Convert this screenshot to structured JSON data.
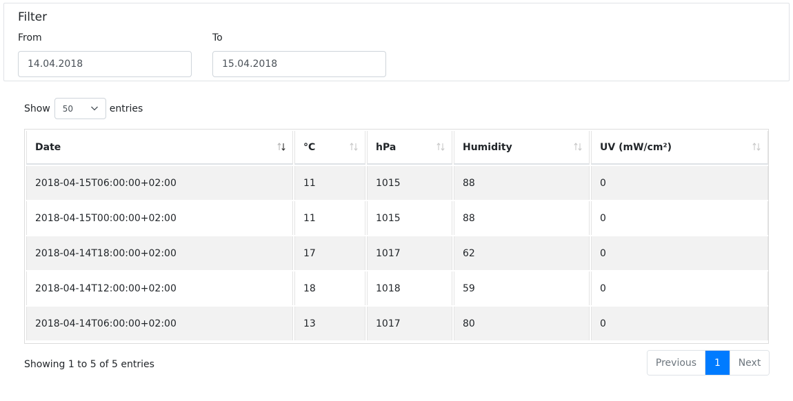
{
  "filter": {
    "title": "Filter",
    "from_label": "From",
    "from_value": "14.04.2018",
    "to_label": "To",
    "to_value": "15.04.2018"
  },
  "length": {
    "show_label": "Show",
    "selected": "50",
    "entries_label": "entries"
  },
  "table": {
    "columns": [
      {
        "label": "Date",
        "sort_icon": "sort-desc-icon"
      },
      {
        "label": "°C",
        "sort_icon": "sort-both-icon"
      },
      {
        "label": "hPa",
        "sort_icon": "sort-both-icon"
      },
      {
        "label": "Humidity",
        "sort_icon": "sort-both-icon"
      },
      {
        "label": "UV (mW/cm²)",
        "sort_icon": "sort-both-icon"
      }
    ],
    "rows": [
      [
        "2018-04-15T06:00:00+02:00",
        "11",
        "1015",
        "88",
        "0"
      ],
      [
        "2018-04-15T00:00:00+02:00",
        "11",
        "1015",
        "88",
        "0"
      ],
      [
        "2018-04-14T18:00:00+02:00",
        "17",
        "1017",
        "62",
        "0"
      ],
      [
        "2018-04-14T12:00:00+02:00",
        "18",
        "1018",
        "59",
        "0"
      ],
      [
        "2018-04-14T06:00:00+02:00",
        "13",
        "1017",
        "80",
        "0"
      ]
    ]
  },
  "info": {
    "text": "Showing 1 to 5 of 5 entries"
  },
  "pagination": {
    "previous": "Previous",
    "current": "1",
    "next": "Next"
  },
  "colors": {
    "accent": "#007bff",
    "stripe": "#f2f2f2"
  }
}
